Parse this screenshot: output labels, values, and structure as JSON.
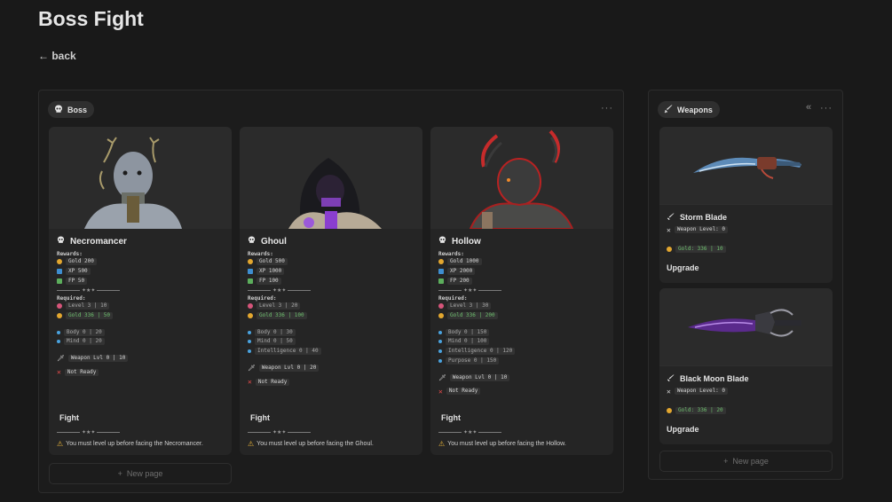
{
  "page": {
    "title": "Boss Fight",
    "back": "← back"
  },
  "boss_board": {
    "label": "Boss",
    "menu": "···",
    "new_page": "New page",
    "cards": [
      {
        "name": "Necromancer",
        "rewards_label": "Rewards:",
        "gold": "Gold 200",
        "xp": "XP 500",
        "fp": "FP 50",
        "divider": "✦★✦",
        "required_label": "Required:",
        "level": "Level 3 | 10",
        "gold_req": "Gold 336 | 50",
        "stats": [
          "Body 0 | 20",
          "Mind 0 | 20"
        ],
        "weapon": "Weapon Lvl 0 | 10",
        "status": "Not Ready",
        "fight": "Fight",
        "warning": "You must level up before facing the Necromancer."
      },
      {
        "name": "Ghoul",
        "rewards_label": "Rewards:",
        "gold": "Gold 500",
        "xp": "XP 1000",
        "fp": "FP 100",
        "divider": "✦★✦",
        "required_label": "Required:",
        "level": "Level 3 | 20",
        "gold_req": "Gold 336 | 100",
        "stats": [
          "Body 0 | 30",
          "Mind 0 | 50",
          "Intelligence 0 | 40"
        ],
        "weapon": "Weapon Lvl 0 | 20",
        "status": "Not Ready",
        "fight": "Fight",
        "warning": "You must level up before facing the Ghoul."
      },
      {
        "name": "Hollow",
        "rewards_label": "Rewards:",
        "gold": "Gold 1000",
        "xp": "XP 2000",
        "fp": "FP 200",
        "divider": "✦★✦",
        "required_label": "Required:",
        "level": "Level 3 | 30",
        "gold_req": "Gold 336 | 200",
        "stats": [
          "Body 0 | 150",
          "Mind 0 | 100",
          "Intelligence 0 | 120",
          "Purpose 0 | 150"
        ],
        "weapon": "Weapon Lvl 0 | 10",
        "status": "Not Ready",
        "fight": "Fight",
        "warning": "You must level up before facing the Hollow."
      }
    ]
  },
  "weapons_board": {
    "label": "Weapons",
    "collapse": "«",
    "menu": "···",
    "new_page": "New page",
    "cards": [
      {
        "name": "Storm Blade",
        "level": "Weapon Level: 0",
        "gold": "Gold: 336 | 10",
        "upgrade": "Upgrade"
      },
      {
        "name": "Black Moon Blade",
        "level": "Weapon Level: 0",
        "gold": "Gold: 336 | 20",
        "upgrade": "Upgrade"
      }
    ]
  },
  "colors": {
    "background": "#191919",
    "card": "#252525",
    "gold_icon": "#e3a72f",
    "xp_icon": "#3e8ed0",
    "fp_icon": "#5cae5c",
    "level_icon": "#d6557a",
    "stat_icon": "#4aa3df",
    "status_red": "#e24a4a",
    "warning": "#e4b13a",
    "gold_text": "#6ec06e"
  },
  "icons": {
    "boss": "skull-icon",
    "weapons": "sword-icon",
    "back": "arrow-left",
    "status": "x-mark-icon",
    "warning": "warning-icon",
    "new_page": "plus-icon"
  }
}
